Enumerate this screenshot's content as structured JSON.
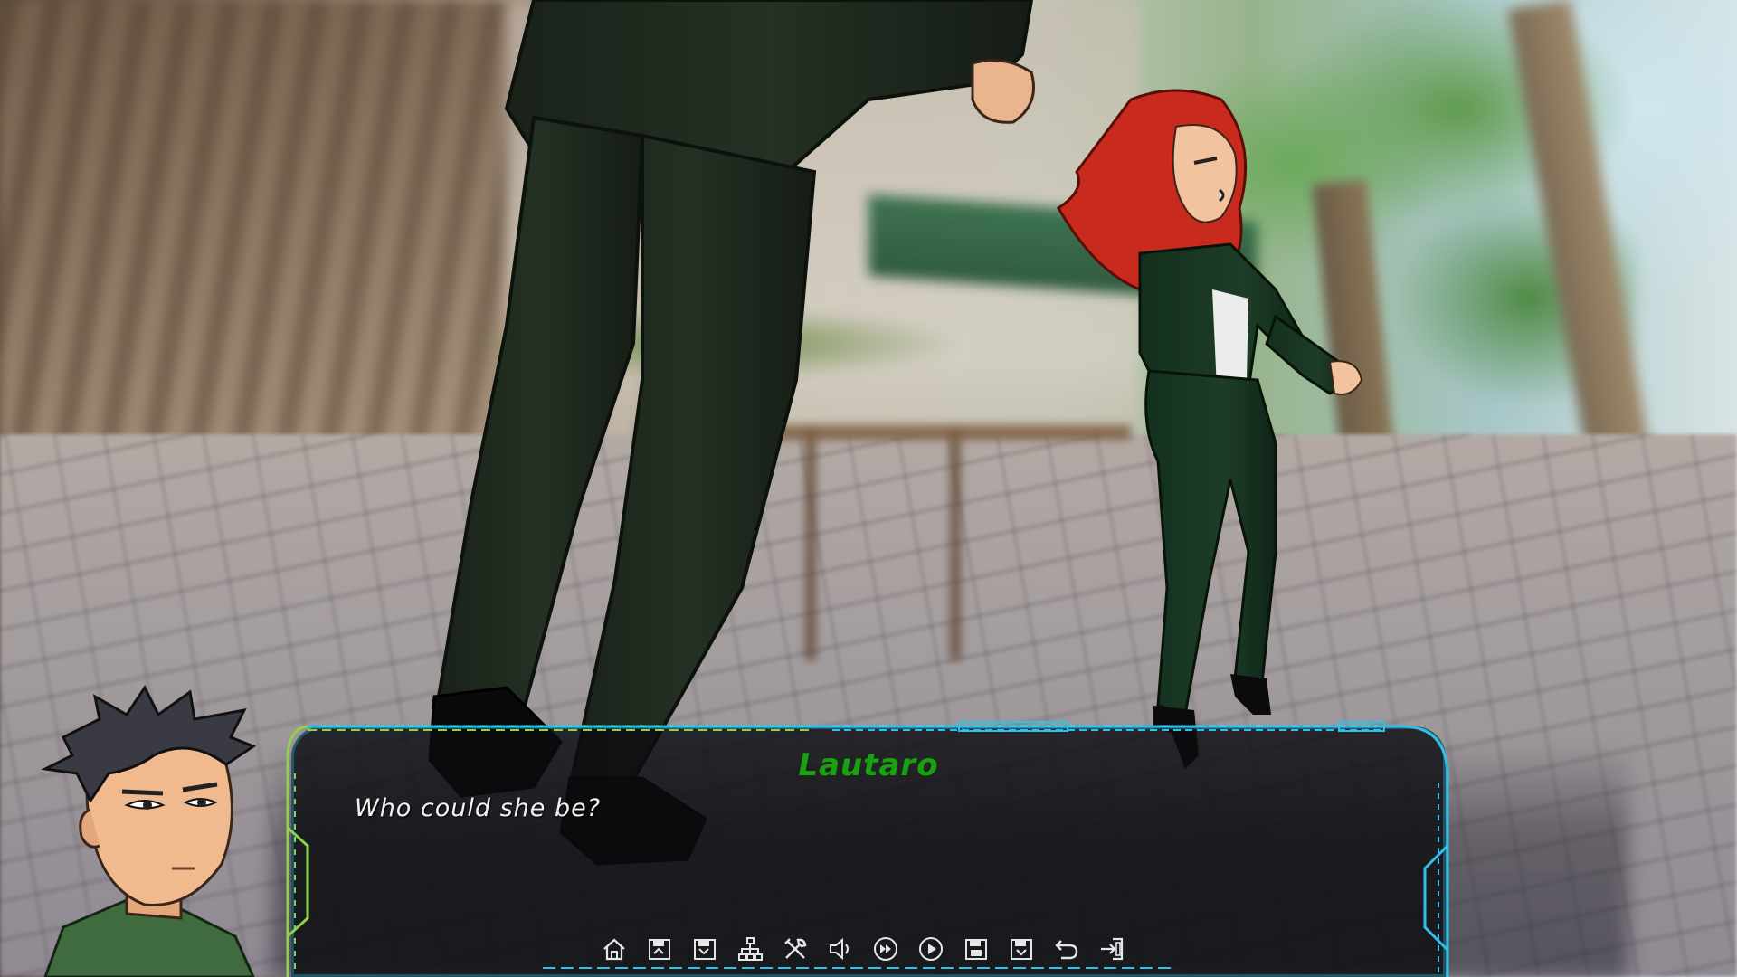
{
  "dialogue": {
    "speaker": "Lautaro",
    "text": "Who could she be?"
  },
  "quick_menu": [
    {
      "icon": "home-icon"
    },
    {
      "icon": "save-icon"
    },
    {
      "icon": "load-icon"
    },
    {
      "icon": "branch-icon"
    },
    {
      "icon": "settings-tools-icon"
    },
    {
      "icon": "volume-icon"
    },
    {
      "icon": "skip-icon"
    },
    {
      "icon": "auto-play-icon"
    },
    {
      "icon": "quick-save-icon"
    },
    {
      "icon": "quick-load-icon"
    },
    {
      "icon": "rollback-icon"
    },
    {
      "icon": "exit-icon"
    }
  ],
  "colors": {
    "speaker_name": "#1aa012",
    "frame_cyan": "#2ec3e6",
    "frame_green": "#8fd14a",
    "box_bg": "#0c0c10",
    "dialogue_text": "#f2f2f2"
  }
}
